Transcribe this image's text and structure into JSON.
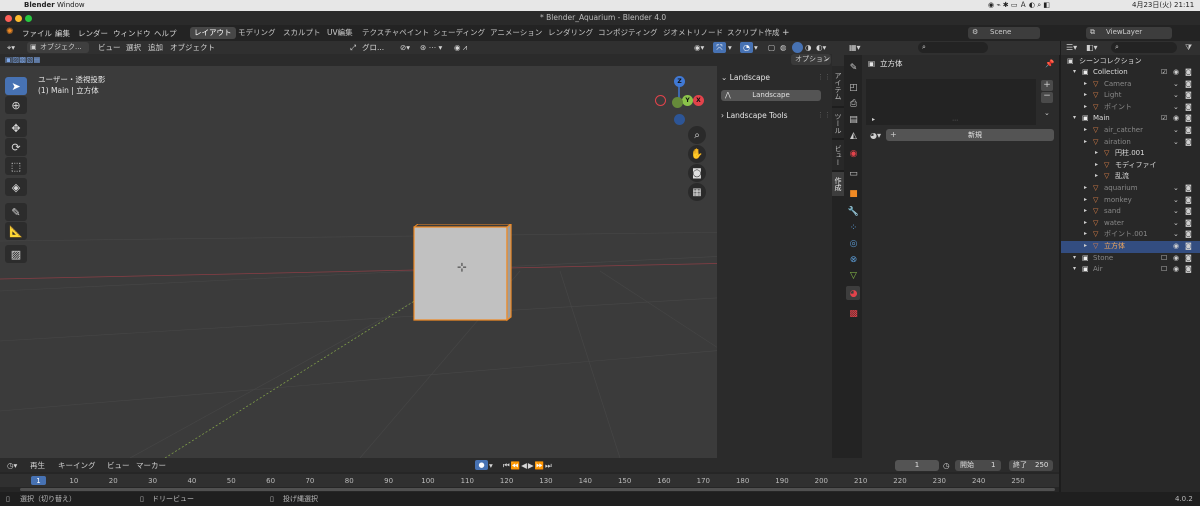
{
  "menubar": {
    "app": "Blender",
    "window": "Window",
    "datetime": "4月23日(火) 21:11"
  },
  "window": {
    "title": "* Blender_Aquarium - Blender 4.0"
  },
  "top_menu": [
    "ファイル",
    "編集",
    "レンダー",
    "ウィンドウ",
    "ヘルプ"
  ],
  "workspaces": [
    "レイアウト",
    "モデリング",
    "スカルプト",
    "UV編集",
    "テクスチャペイント",
    "シェーディング",
    "アニメーション",
    "レンダリング",
    "コンポジティング",
    "ジオメトリノード",
    "スクリプト作成"
  ],
  "active_workspace": "レイアウト",
  "scene": {
    "name": "Scene",
    "view_layer": "ViewLayer"
  },
  "viewport": {
    "mode": "オブジェク...",
    "menus": [
      "ビュー",
      "選択",
      "追加",
      "オブジェクト"
    ],
    "transform": "グロ...",
    "options": "オプション",
    "info_line1": "ユーザー・透視投影",
    "info_line2": "(1) Main | 立方体"
  },
  "npanel": {
    "section1": "Landscape",
    "button": "Landscape",
    "section2": "Landscape Tools",
    "tabs": [
      "アイテム",
      "ツール",
      "ビュー",
      "作成"
    ]
  },
  "properties": {
    "object_name": "立方体",
    "new_button": "新規"
  },
  "outliner": {
    "title": "シーンコレクション",
    "rows": [
      {
        "label": "Collection",
        "indent": 1
      },
      {
        "label": "Camera",
        "indent": 2
      },
      {
        "label": "Light",
        "indent": 2
      },
      {
        "label": "ポイント",
        "indent": 2
      },
      {
        "label": "Main",
        "indent": 1
      },
      {
        "label": "air_catcher",
        "indent": 2
      },
      {
        "label": "airation",
        "indent": 2
      },
      {
        "label": "円柱.001",
        "indent": 3
      },
      {
        "label": "モディファイ",
        "indent": 3
      },
      {
        "label": "乱流",
        "indent": 3
      },
      {
        "label": "aquarium",
        "indent": 2
      },
      {
        "label": "monkey",
        "indent": 2
      },
      {
        "label": "sand",
        "indent": 2
      },
      {
        "label": "water",
        "indent": 2
      },
      {
        "label": "ポイント.001",
        "indent": 2
      },
      {
        "label": "立方体",
        "indent": 2
      },
      {
        "label": "Stone",
        "indent": 1
      },
      {
        "label": "Air",
        "indent": 1
      }
    ],
    "selected": "立方体"
  },
  "timeline": {
    "menus": [
      "再生",
      "キーイング",
      "ビュー",
      "マーカー"
    ],
    "current_frame": "1",
    "start_label": "開始",
    "start": "1",
    "end_label": "終了",
    "end": "250",
    "ticks": [
      "1",
      "10",
      "20",
      "30",
      "40",
      "50",
      "60",
      "70",
      "80",
      "90",
      "100",
      "110",
      "120",
      "130",
      "140",
      "150",
      "160",
      "170",
      "180",
      "190",
      "200",
      "210",
      "220",
      "230",
      "240",
      "250"
    ]
  },
  "status": {
    "select": "選択（切り替え）",
    "dolly": "ドリービュー",
    "lasso": "投げ縄選択",
    "version": "4.0.2"
  },
  "colors": {
    "accent": "#4772b3",
    "selection": "#f08a24",
    "x_axis": "#e2434b",
    "y_axis": "#8bc34a",
    "z_axis": "#4079d5"
  }
}
